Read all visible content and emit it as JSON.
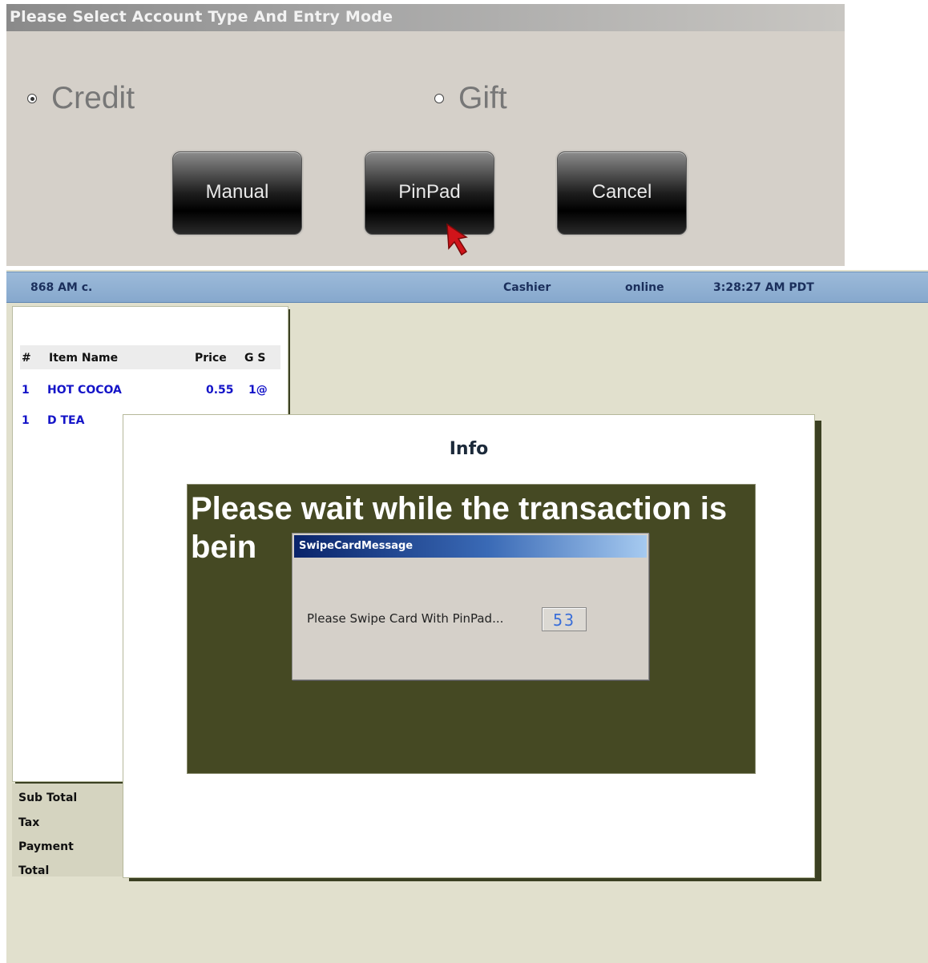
{
  "top_dialog": {
    "title": "Please Select Account Type And Entry Mode",
    "radios": {
      "credit": {
        "label": "Credit",
        "selected": true
      },
      "gift": {
        "label": "Gift",
        "selected": false
      }
    },
    "buttons": {
      "manual": "Manual",
      "pinpad": "PinPad",
      "cancel": "Cancel"
    }
  },
  "status_bar": {
    "left_text": "868 AM  c.",
    "cashier": "Cashier",
    "online": "online",
    "time": "3:28:27 AM PDT"
  },
  "receipt": {
    "columns": {
      "num": "#",
      "item": "Item Name",
      "price": "Price",
      "gs": "G S"
    },
    "rows": [
      {
        "num": "1",
        "item": "HOT COCOA",
        "price": "0.55",
        "gs": "1@"
      },
      {
        "num": "1",
        "item": "D TEA",
        "price": "",
        "gs": ""
      }
    ],
    "totals": {
      "subtotal": "Sub Total",
      "tax": "Tax",
      "payment": "Payment",
      "total": "Total"
    }
  },
  "info_dialog": {
    "title": "Info",
    "message": "Please wait while the transaction is bein"
  },
  "swipe_dialog": {
    "title": "SwipeCardMessage",
    "message": "Please Swipe Card With PinPad...",
    "countdown": "53"
  },
  "colors": {
    "status_text": "#1b2f5c",
    "item_text": "#1414c8",
    "info_box": "#454923",
    "background": "#e1e0cd"
  },
  "icons": [
    "radio-selected-icon",
    "radio-unselected-icon",
    "mouse-pointer-icon"
  ]
}
